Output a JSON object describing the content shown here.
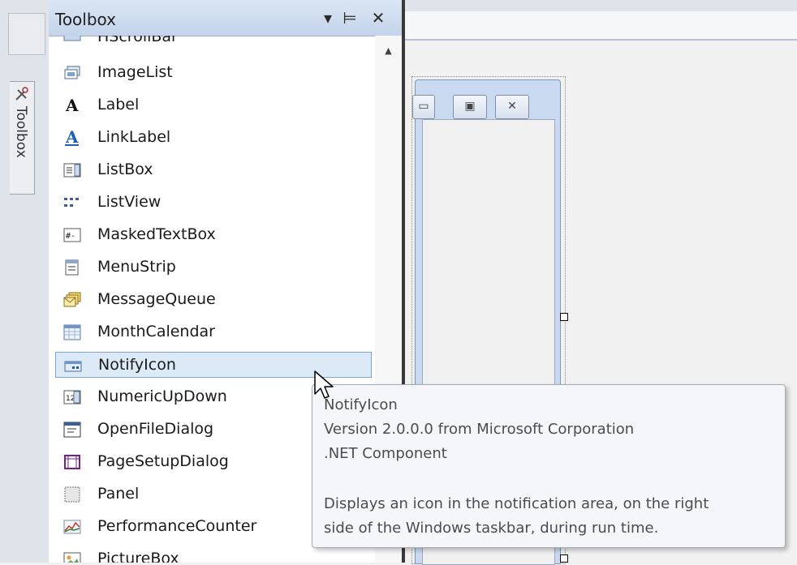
{
  "side_tab": {
    "label": "Toolbox",
    "icon": "toolbox-icon"
  },
  "toolbox": {
    "title": "Toolbox",
    "header_buttons": {
      "menu": "▾",
      "pin": "⊨",
      "close": "✕"
    },
    "partial_top_item": "HScrollBar",
    "items": [
      {
        "label": "ImageList",
        "icon": "imagelist-icon"
      },
      {
        "label": "Label",
        "icon": "label-icon"
      },
      {
        "label": "LinkLabel",
        "icon": "linklabel-icon"
      },
      {
        "label": "ListBox",
        "icon": "listbox-icon"
      },
      {
        "label": "ListView",
        "icon": "listview-icon"
      },
      {
        "label": "MaskedTextBox",
        "icon": "maskedtextbox-icon"
      },
      {
        "label": "MenuStrip",
        "icon": "menustrip-icon"
      },
      {
        "label": "MessageQueue",
        "icon": "messagequeue-icon"
      },
      {
        "label": "MonthCalendar",
        "icon": "monthcalendar-icon"
      },
      {
        "label": "NotifyIcon",
        "icon": "notifyicon-icon",
        "selected": true
      },
      {
        "label": "NumericUpDown",
        "icon": "numericupdown-icon"
      },
      {
        "label": "OpenFileDialog",
        "icon": "openfiledialog-icon"
      },
      {
        "label": "PageSetupDialog",
        "icon": "pagesetupdialog-icon"
      },
      {
        "label": "Panel",
        "icon": "panel-icon"
      },
      {
        "label": "PerformanceCounter",
        "icon": "performancecounter-icon"
      },
      {
        "label": "PictureBox",
        "icon": "picturebox-icon"
      }
    ]
  },
  "tooltip": {
    "name": "NotifyIcon",
    "version": "Version 2.0.0.0 from Microsoft Corporation",
    "type": ".NET Component",
    "description_line1": "Displays an icon in the notification area, on the right",
    "description_line2": "side of the Windows taskbar, during run time."
  },
  "colors": {
    "header_gradient_top": "#dbe6f4",
    "selection_fill": "#dceaf8",
    "selection_border": "#7ea6cf",
    "link_blue": "#1b5fb5"
  }
}
